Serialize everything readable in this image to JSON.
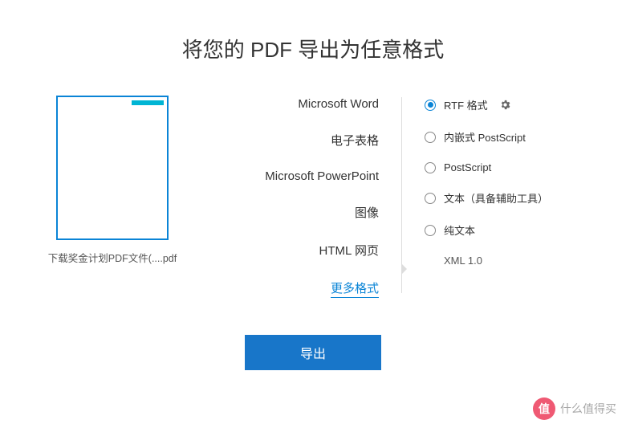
{
  "title": "将您的 PDF 导出为任意格式",
  "file": {
    "name": "下载奖金计划PDF文件(....pdf"
  },
  "categories": [
    {
      "label": "Microsoft Word",
      "active": false
    },
    {
      "label": "电子表格",
      "active": false
    },
    {
      "label": "Microsoft PowerPoint",
      "active": false
    },
    {
      "label": "图像",
      "active": false
    },
    {
      "label": "HTML 网页",
      "active": false
    },
    {
      "label": "更多格式",
      "active": true
    }
  ],
  "options": [
    {
      "label": "RTF 格式",
      "selected": true,
      "has_settings": true
    },
    {
      "label": "内嵌式 PostScript",
      "selected": false
    },
    {
      "label": "PostScript",
      "selected": false
    },
    {
      "label": "文本（具备辅助工具）",
      "selected": false
    },
    {
      "label": "纯文本",
      "selected": false
    },
    {
      "label": "XML 1.0",
      "selected": false,
      "noradio": true
    }
  ],
  "export_button": "导出",
  "watermark": {
    "badge": "值",
    "text": "什么值得买"
  }
}
